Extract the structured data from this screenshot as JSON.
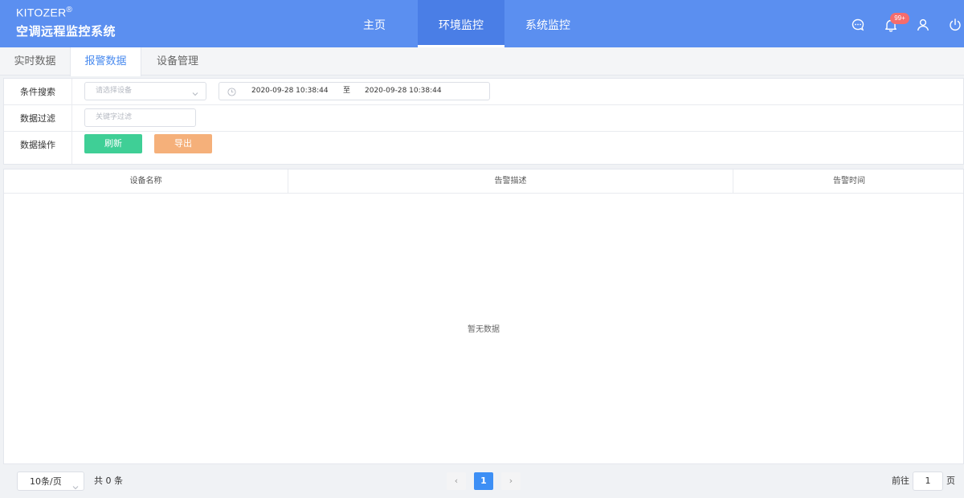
{
  "header": {
    "brand_name": "KITOZER",
    "brand_mark": "®",
    "system_title": "空调远程监控系统",
    "nav": [
      {
        "label": "主页",
        "active": false
      },
      {
        "label": "环境监控",
        "active": true
      },
      {
        "label": "系统监控",
        "active": false
      }
    ],
    "notification_count": "99+",
    "icons": [
      "chat-icon",
      "bell-icon",
      "user-icon",
      "power-icon"
    ]
  },
  "subtabs": [
    {
      "label": "实时数据",
      "active": false
    },
    {
      "label": "报警数据",
      "active": true
    },
    {
      "label": "设备管理",
      "active": false
    }
  ],
  "filter": {
    "search_label": "条件搜索",
    "device_placeholder": "请选择设备",
    "date_start": "2020-09-28 10:38:44",
    "date_sep": "至",
    "date_end": "2020-09-28 10:38:44",
    "filter_label": "数据过滤",
    "keyword_placeholder": "关键字过滤",
    "ops_label": "数据操作",
    "refresh_label": "刷新",
    "export_label": "导出"
  },
  "table": {
    "columns": [
      "设备名称",
      "告警描述",
      "告警时间"
    ],
    "rows": [],
    "empty_text": "暂无数据"
  },
  "pagination": {
    "page_size": "10条/页",
    "total": "共 0 条",
    "prev": "‹",
    "current_page": "1",
    "next": "›",
    "goto_label": "前往",
    "goto_value": "1",
    "goto_unit": "页"
  },
  "colors": {
    "header_bg": "#5b8ff0",
    "active_tab_text": "#4a8bef",
    "refresh_btn": "#3fcf96",
    "export_btn": "#f5b07a",
    "badge": "#f56c6c",
    "page_active": "#3d8ff5"
  }
}
